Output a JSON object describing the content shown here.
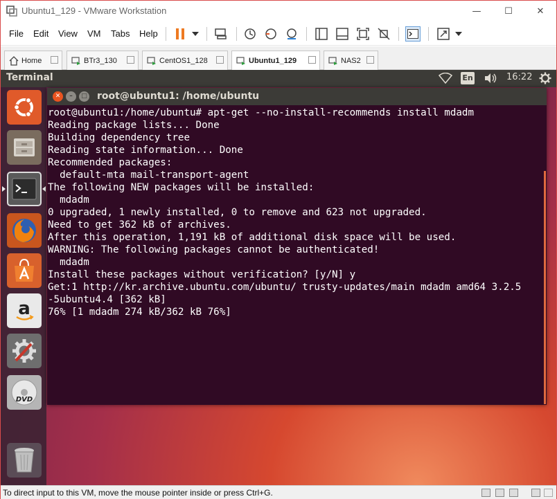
{
  "window": {
    "title": "Ubuntu1_129 - VMware Workstation",
    "minimize_glyph": "—",
    "maximize_glyph": "☐",
    "close_glyph": "✕"
  },
  "menu": {
    "file": "File",
    "edit": "Edit",
    "view": "View",
    "vm": "VM",
    "tabs": "Tabs",
    "help": "Help"
  },
  "tabs": [
    {
      "label": "Home",
      "active": false
    },
    {
      "label": "BTr3_130",
      "active": false
    },
    {
      "label": "CentOS1_128",
      "active": false
    },
    {
      "label": "Ubuntu1_129",
      "active": true
    },
    {
      "label": "NAS2",
      "active": false
    }
  ],
  "ubuntu_panel": {
    "app_title": "Terminal",
    "lang": "En",
    "clock": "16:22"
  },
  "terminal": {
    "title": "root@ubuntu1: /home/ubuntu",
    "lines": [
      "root@ubuntu1:/home/ubuntu# apt-get --no-install-recommends install mdadm",
      "Reading package lists... Done",
      "Building dependency tree",
      "Reading state information... Done",
      "Recommended packages:",
      "  default-mta mail-transport-agent",
      "The following NEW packages will be installed:",
      "  mdadm",
      "0 upgraded, 1 newly installed, 0 to remove and 623 not upgraded.",
      "Need to get 362 kB of archives.",
      "After this operation, 1,191 kB of additional disk space will be used.",
      "WARNING: The following packages cannot be authenticated!",
      "  mdadm",
      "Install these packages without verification? [y/N] y",
      "Get:1 http://kr.archive.ubuntu.com/ubuntu/ trusty-updates/main mdadm amd64 3.2.5",
      "-5ubuntu4.4 [362 kB]",
      "76% [1 mdadm 274 kB/362 kB 76%]"
    ]
  },
  "statusbar": {
    "text": "To direct input to this VM, move the mouse pointer inside or press Ctrl+G."
  },
  "colors": {
    "terminal_bg": "#300a24",
    "panel_bg": "#3c3b37",
    "close_btn": "#e95420",
    "window_border": "#d94b4b"
  }
}
